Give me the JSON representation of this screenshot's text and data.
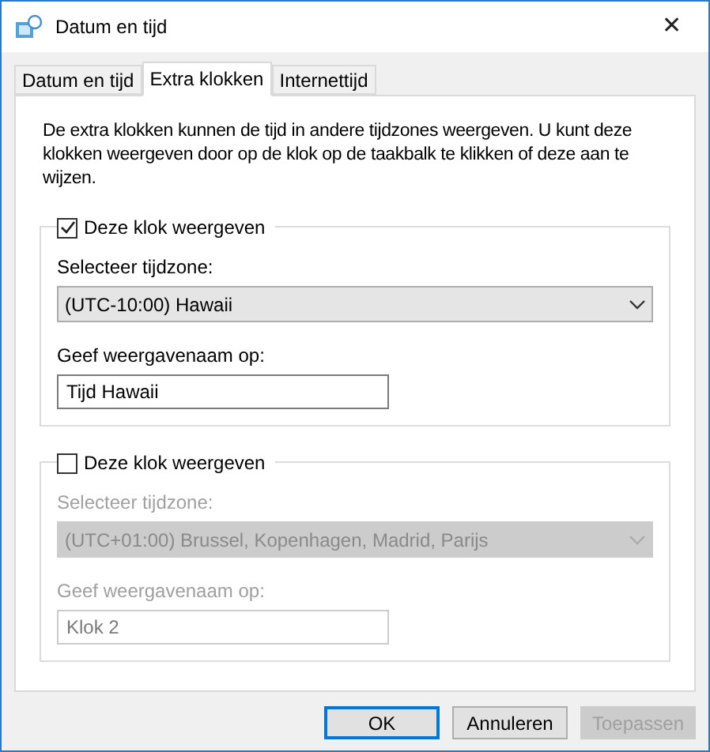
{
  "window": {
    "title": "Datum en tijd",
    "close": "✕"
  },
  "tabs": [
    {
      "label": "Datum en tijd",
      "selected": false
    },
    {
      "label": "Extra klokken",
      "selected": true
    },
    {
      "label": "Internettijd",
      "selected": false
    }
  ],
  "description": "De extra klokken kunnen de tijd in andere tijdzones weergeven. U kunt deze klokken weergeven door op de klok op de taakbalk te klikken of deze aan te wijzen.",
  "clocks": [
    {
      "checkbox_label": "Deze klok weergeven",
      "checked": true,
      "timezone_label": "Selecteer tijdzone:",
      "timezone": "(UTC-10:00) Hawaii",
      "name_label": "Geef weergavenaam op:",
      "name": "Tijd Hawaii"
    },
    {
      "checkbox_label": "Deze klok weergeven",
      "checked": false,
      "timezone_label": "Selecteer tijdzone:",
      "timezone": "(UTC+01:00) Brussel, Kopenhagen, Madrid, Parijs",
      "name_label": "Geef weergavenaam op:",
      "name": "Klok 2"
    }
  ],
  "buttons": [
    {
      "label": "OK",
      "kind": "default",
      "disabled": false
    },
    {
      "label": "Annuleren",
      "kind": "normal",
      "disabled": false
    },
    {
      "label": "Toepassen",
      "kind": "normal",
      "disabled": true
    }
  ]
}
